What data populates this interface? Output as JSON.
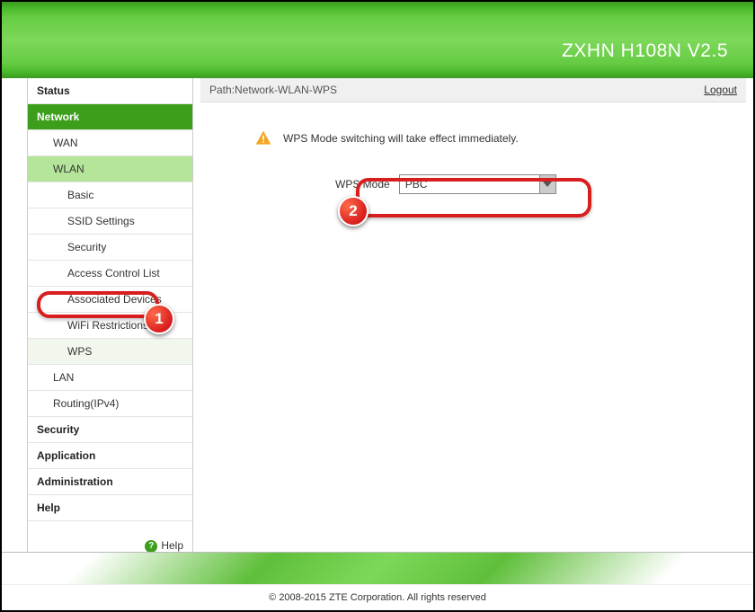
{
  "header": {
    "title": "ZXHN H108N V2.5"
  },
  "pathbar": {
    "prefix": "Path:",
    "path": "Network-WLAN-WPS",
    "logout": "Logout"
  },
  "sidebar": {
    "status": "Status",
    "network": "Network",
    "wan": "WAN",
    "wlan": "WLAN",
    "basic": "Basic",
    "ssid": "SSID Settings",
    "security": "Security",
    "acl": "Access Control List",
    "assoc": "Associated Devices",
    "wifir": "WiFi Restrictions",
    "wps": "WPS",
    "lan": "LAN",
    "routing": "Routing(IPv4)",
    "sec": "Security",
    "app": "Application",
    "admin": "Administration",
    "help": "Help",
    "helpBtn": "Help"
  },
  "notice": {
    "text": "WPS Mode switching will take effect immediately."
  },
  "form": {
    "label": "WPS Mode",
    "value": "PBC"
  },
  "footer": {
    "copyright": "© 2008-2015 ZTE Corporation. All rights reserved"
  },
  "annotations": {
    "b1": "1",
    "b2": "2"
  }
}
